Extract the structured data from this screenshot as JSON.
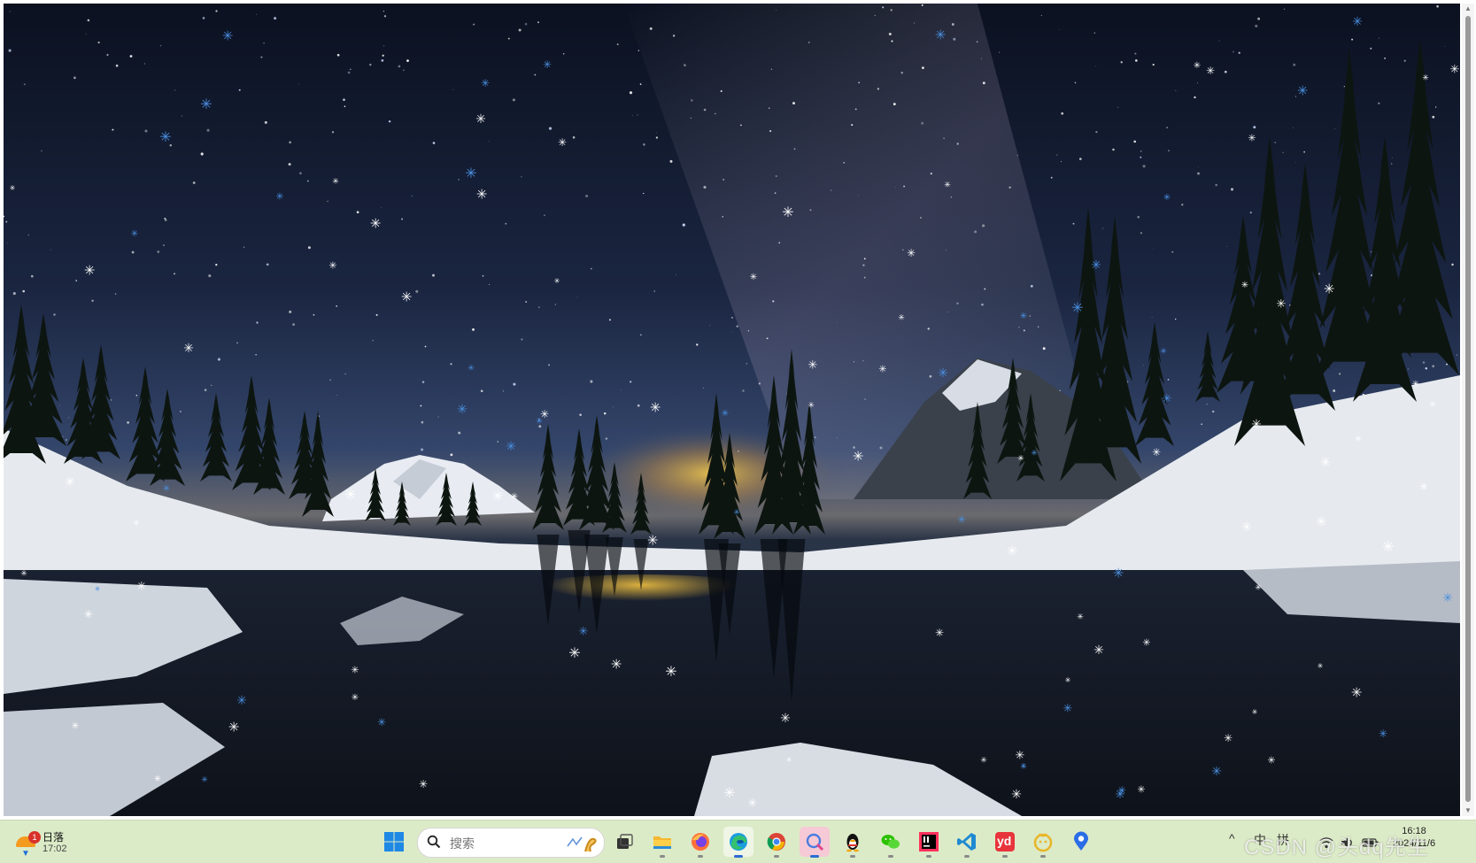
{
  "wallpaper": {
    "description_icon": "landscape-night-image",
    "colors": {
      "sky_top": "#0d1424",
      "sky_mid": "#1f2d49",
      "sky_glow": "#f2c94c",
      "snow": "#eef2f6",
      "water": "#141a24"
    }
  },
  "taskbar": {
    "weather": {
      "label": "日落",
      "time": "17:02",
      "badge": "1"
    },
    "search": {
      "placeholder": "搜索"
    },
    "pinned": [
      {
        "name": "start",
        "icon": "windows-logo-icon"
      },
      {
        "name": "task-view",
        "icon": "task-view-icon"
      },
      {
        "name": "file-explorer",
        "icon": "folder-icon"
      },
      {
        "name": "firefox",
        "icon": "firefox-icon"
      },
      {
        "name": "edge",
        "icon": "edge-icon"
      },
      {
        "name": "chrome",
        "icon": "chrome-icon"
      },
      {
        "name": "screen-capture",
        "icon": "capture-icon"
      },
      {
        "name": "qq",
        "icon": "qq-penguin-icon"
      },
      {
        "name": "wechat",
        "icon": "wechat-icon"
      },
      {
        "name": "intellij",
        "icon": "intellij-icon"
      },
      {
        "name": "vscode",
        "icon": "vscode-icon"
      },
      {
        "name": "youdao",
        "icon": "youdao-icon",
        "text": "yd"
      },
      {
        "name": "duck-app",
        "icon": "duck-icon"
      },
      {
        "name": "maps",
        "icon": "map-pin-icon"
      }
    ],
    "tray": {
      "chevron": "^",
      "ime": "中",
      "ime_layout": "拼",
      "clock_time": "16:18",
      "clock_date": "2024/11/6"
    }
  },
  "watermark": "CSDN @头dq先生"
}
